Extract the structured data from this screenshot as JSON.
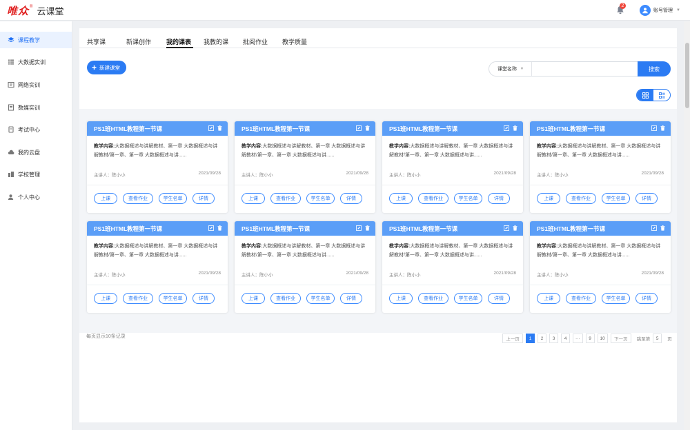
{
  "app": {
    "logo_mark": "唯众",
    "logo_reg": "®",
    "logo_text": "云课堂"
  },
  "header": {
    "notification_count": "2",
    "account_name": "账号管理"
  },
  "sidebar": {
    "items": [
      {
        "label": "课程教学",
        "icon": "layers-icon"
      },
      {
        "label": "大数据实训",
        "icon": "list-icon"
      },
      {
        "label": "网络实训",
        "icon": "network-icon"
      },
      {
        "label": "数媒实训",
        "icon": "media-icon"
      },
      {
        "label": "考试中心",
        "icon": "exam-icon"
      },
      {
        "label": "我的云盘",
        "icon": "cloud-icon"
      },
      {
        "label": "学校管理",
        "icon": "building-icon"
      },
      {
        "label": "个人中心",
        "icon": "user-icon"
      }
    ]
  },
  "tabs": [
    "共享课",
    "新课创作",
    "我的课表",
    "我教的课",
    "批阅作业",
    "教学质量"
  ],
  "toolbar": {
    "new_button": "新建课堂",
    "search_select": "课堂名称",
    "search_placeholder": "",
    "search_button": "搜索"
  },
  "card_common": {
    "title": "PS1班HTML教程第一节课",
    "content_label": "教学内容:",
    "content_text": "大数据概述与讲解教材、第一章 大数据概述与讲解教材/第一章、第一章 大数据概述与讲......",
    "lecturer": "主讲人：陈小小",
    "date": "2021/09/28",
    "actions": [
      "上课",
      "查看作业",
      "学生名单",
      "详情"
    ]
  },
  "footer": {
    "per_page": "每页显示10条记录"
  },
  "pagination": {
    "prev": "上一页",
    "pages": [
      "1",
      "2",
      "3",
      "4",
      "···",
      "9",
      "10"
    ],
    "current": "1",
    "next": "下一页",
    "jump_label": "跳至第",
    "jump_value": "5",
    "jump_suffix": "页"
  },
  "colors": {
    "accent": "#2b7bf3",
    "card_header": "#5b9ef7",
    "badge": "#f0473b",
    "brand_red": "#e02020"
  }
}
